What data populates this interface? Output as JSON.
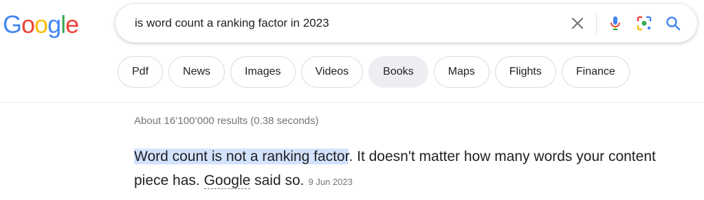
{
  "logo": {
    "text": [
      "G",
      "o",
      "o",
      "g",
      "l",
      "e"
    ]
  },
  "search": {
    "query": "is word count a ranking factor in 2023"
  },
  "chips": [
    "Pdf",
    "News",
    "Images",
    "Videos",
    "Books",
    "Maps",
    "Flights",
    "Finance"
  ],
  "stats": "About 16’100’000 results (0.38 seconds)",
  "snippet": {
    "highlight": "Word count is not a ranking factor",
    "rest1": ". It doesn't matter how many words your content piece has. ",
    "link": "Google",
    "rest2": " said so.",
    "date": "9 Jun 2023"
  },
  "colors": {
    "blue": "#4285f4",
    "red": "#ea4335",
    "yellow": "#fbbc05",
    "green": "#34a853",
    "highlight": "#d3e3fd"
  },
  "icons": [
    "close-icon",
    "mic-icon",
    "lens-icon",
    "search-icon"
  ]
}
